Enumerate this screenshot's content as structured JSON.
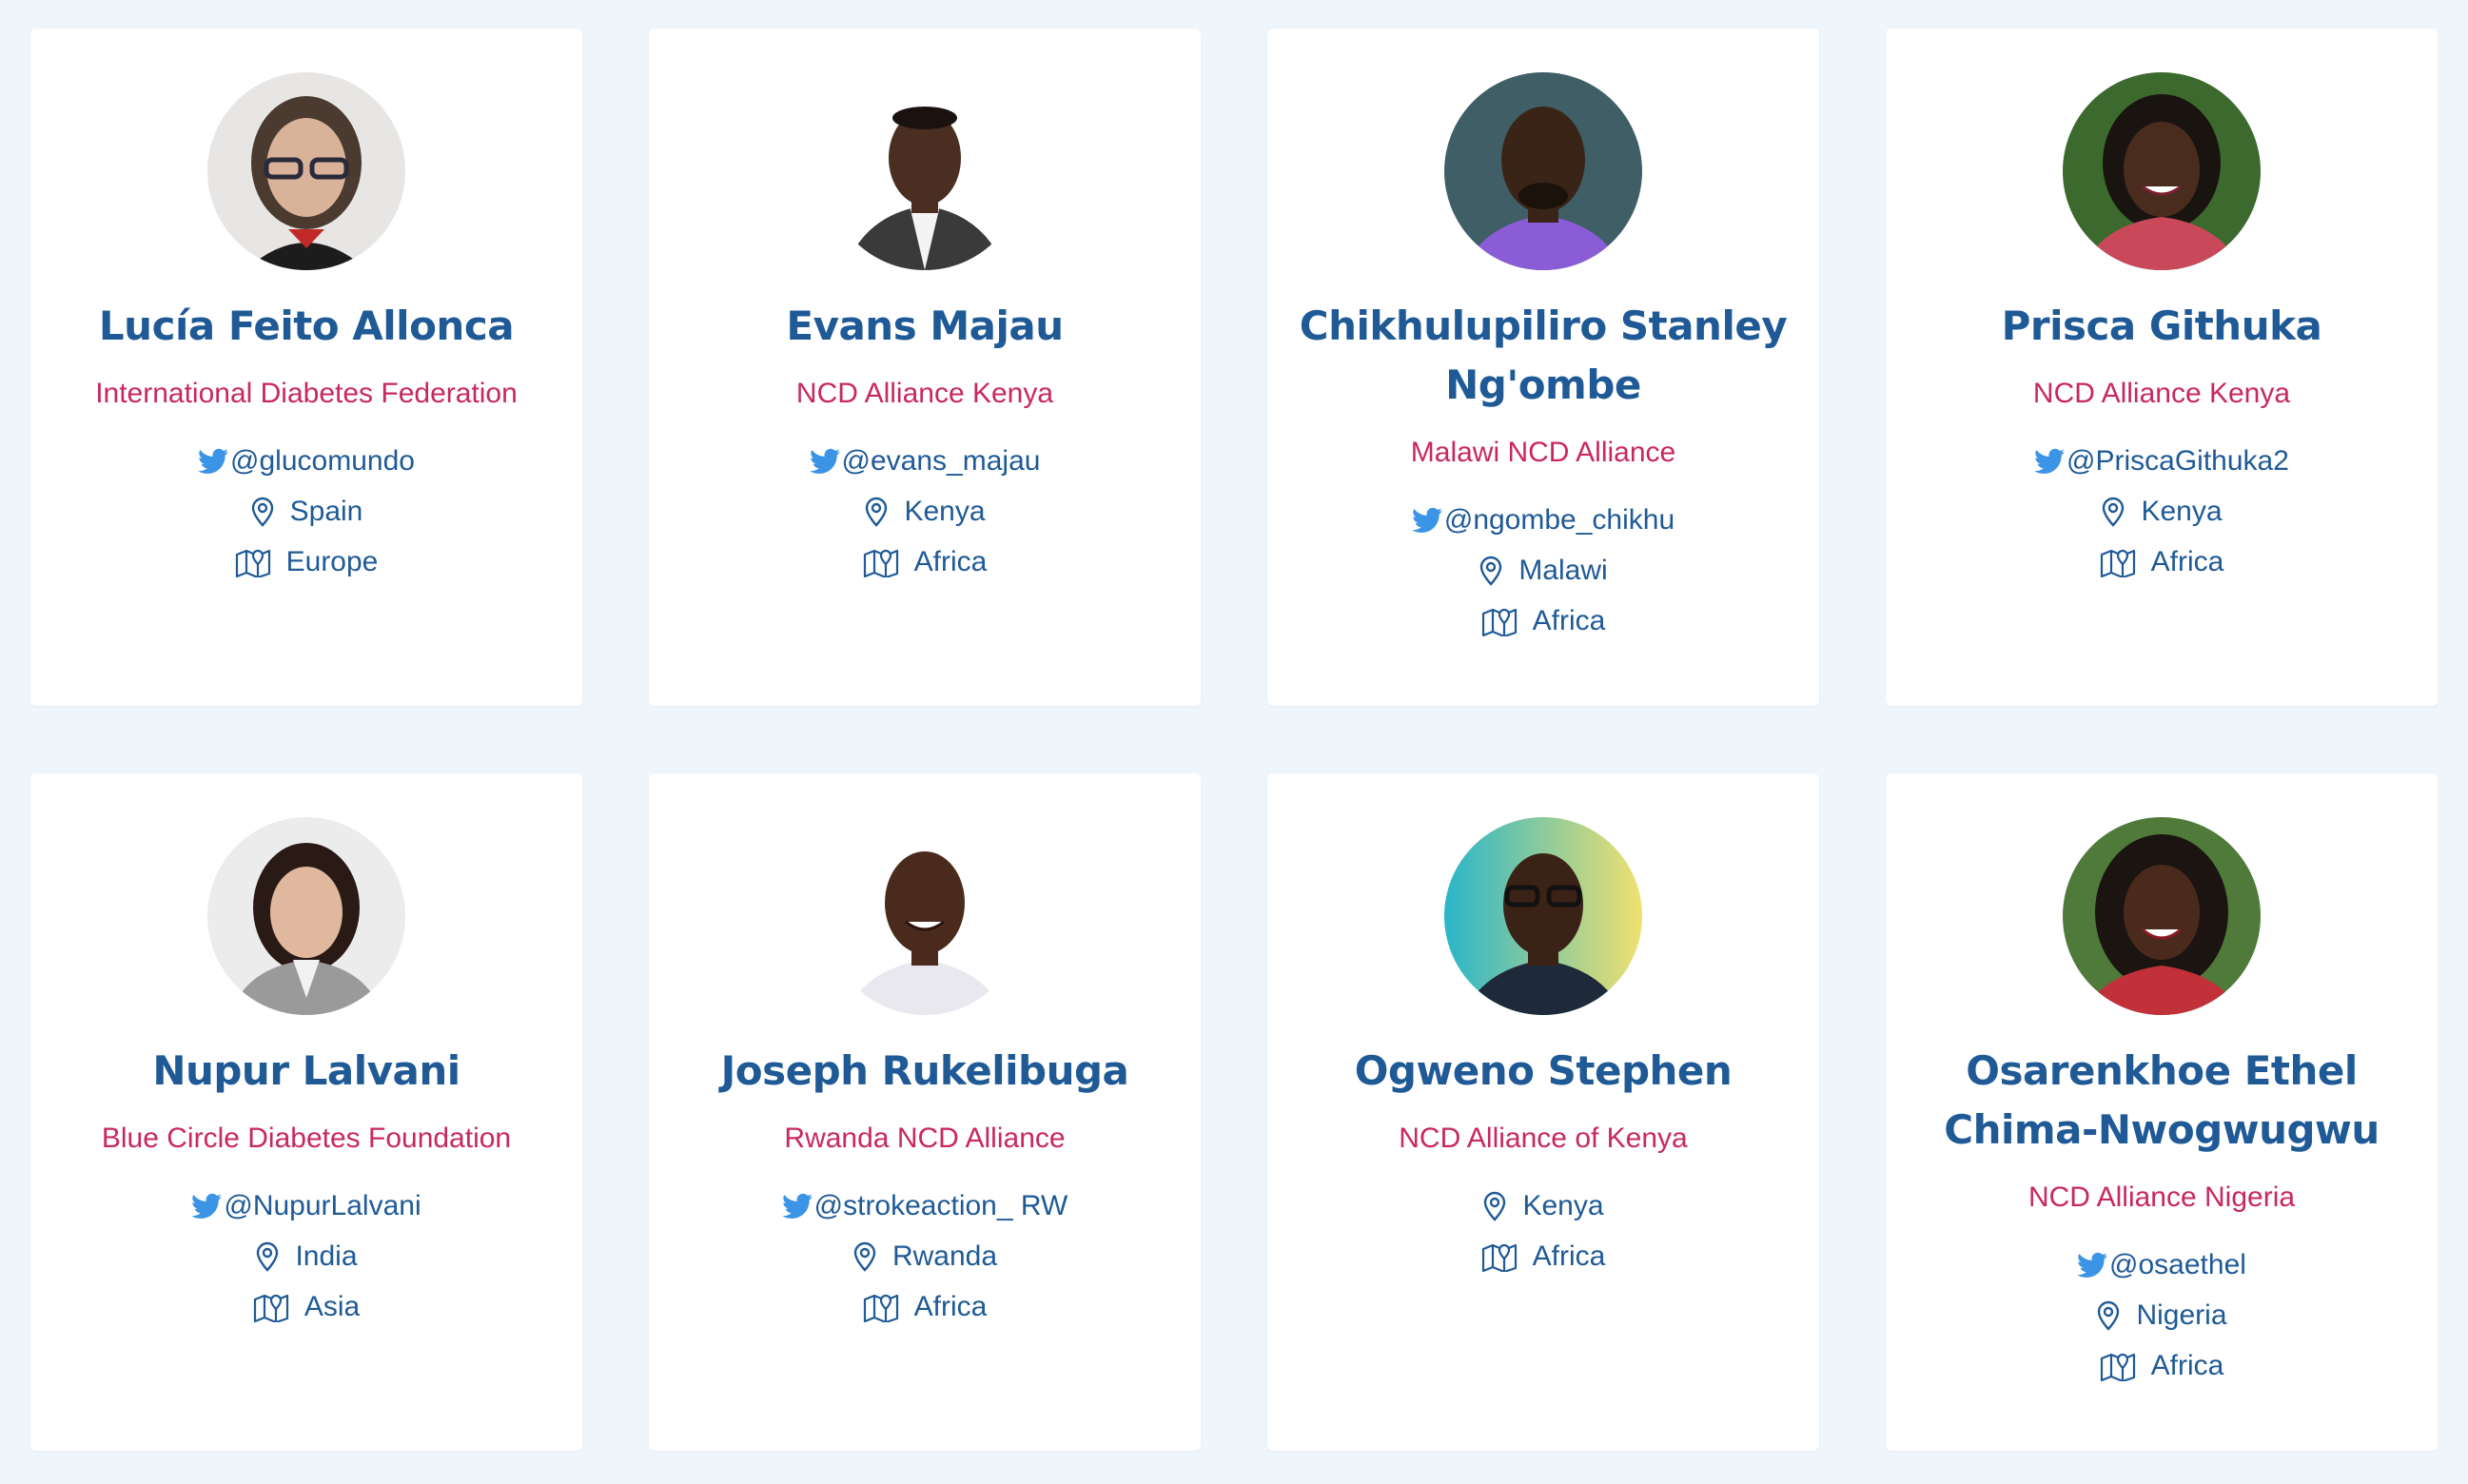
{
  "colors": {
    "background": "#eef5fb",
    "card": "#ffffff",
    "name": "#1f5a96",
    "organization": "#c9285e",
    "meta_text": "#1f5a96",
    "twitter": "#3b94e6"
  },
  "icons": {
    "twitter": "twitter-icon",
    "location": "map-pin-icon",
    "region": "map-icon"
  },
  "people": [
    {
      "name": "Lucía Feito Allonca",
      "org": "International Diabetes Federation",
      "twitter": "@glucomundo",
      "country": "Spain",
      "region": "Europe"
    },
    {
      "name": "Evans Majau",
      "org": "NCD Alliance Kenya",
      "twitter": "@evans_majau",
      "country": "Kenya",
      "region": "Africa"
    },
    {
      "name": "Chikhulupiliro Stanley Ng'ombe",
      "org": "Malawi NCD Alliance",
      "twitter": "@ngombe_chikhu",
      "country": "Malawi",
      "region": "Africa"
    },
    {
      "name": "Prisca Githuka",
      "org": "NCD Alliance Kenya",
      "twitter": "@PriscaGithuka2",
      "country": "Kenya",
      "region": "Africa"
    },
    {
      "name": "Nupur Lalvani",
      "org": "Blue Circle Diabetes Foundation",
      "twitter": "@NupurLalvani",
      "country": "India",
      "region": "Asia"
    },
    {
      "name": "Joseph Rukelibuga",
      "org": "Rwanda NCD Alliance",
      "twitter": "@strokeaction_ RW",
      "country": "Rwanda",
      "region": "Africa"
    },
    {
      "name": "Ogweno Stephen",
      "org": "NCD Alliance of Kenya",
      "country": "Kenya",
      "region": "Africa"
    },
    {
      "name": "Osarenkhoe Ethel Chima-Nwogwugwu",
      "org": "NCD Alliance Nigeria",
      "twitter": "@osaethel",
      "country": "Nigeria",
      "region": "Africa"
    }
  ]
}
